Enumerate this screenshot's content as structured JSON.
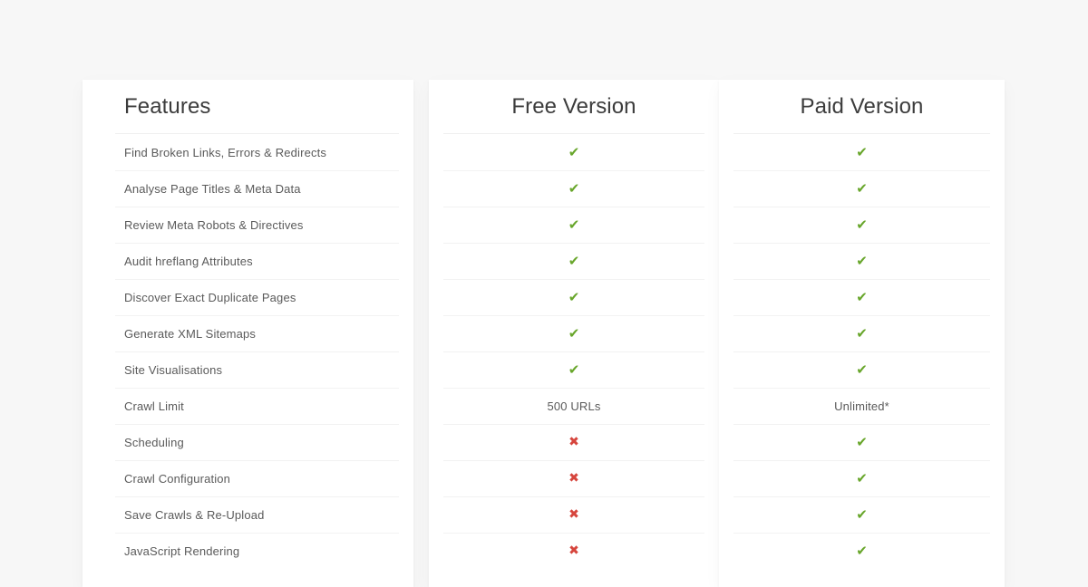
{
  "theme": {
    "page_background": "#f7f7f7",
    "card_background": "#ffffff",
    "divider": "#f2f2f2",
    "heading_color": "#3c3c3c",
    "text_color": "#5a5a5a",
    "yes_color": "#68a62b",
    "no_color": "#d6453d"
  },
  "table": {
    "columns": [
      {
        "key": "features",
        "label": "Features"
      },
      {
        "key": "free",
        "label": "Free Version"
      },
      {
        "key": "paid",
        "label": "Paid Version"
      }
    ],
    "icons": {
      "yes": "✔",
      "no": "✖",
      "yes_name": "check-icon",
      "no_name": "cross-icon"
    },
    "rows": [
      {
        "feature": "Find Broken Links, Errors & Redirects",
        "free": "✔",
        "paid": "✔",
        "free_type": "yes",
        "paid_type": "yes"
      },
      {
        "feature": "Analyse Page Titles & Meta Data",
        "free": "✔",
        "paid": "✔",
        "free_type": "yes",
        "paid_type": "yes"
      },
      {
        "feature": "Review Meta Robots & Directives",
        "free": "✔",
        "paid": "✔",
        "free_type": "yes",
        "paid_type": "yes"
      },
      {
        "feature": "Audit hreflang Attributes",
        "free": "✔",
        "paid": "✔",
        "free_type": "yes",
        "paid_type": "yes"
      },
      {
        "feature": "Discover Exact Duplicate Pages",
        "free": "✔",
        "paid": "✔",
        "free_type": "yes",
        "paid_type": "yes"
      },
      {
        "feature": "Generate XML Sitemaps",
        "free": "✔",
        "paid": "✔",
        "free_type": "yes",
        "paid_type": "yes"
      },
      {
        "feature": "Site Visualisations",
        "free": "✔",
        "paid": "✔",
        "free_type": "yes",
        "paid_type": "yes"
      },
      {
        "feature": "Crawl Limit",
        "free": "500 URLs",
        "paid": "Unlimited*",
        "free_type": "text",
        "paid_type": "text"
      },
      {
        "feature": "Scheduling",
        "free": "✖",
        "paid": "✔",
        "free_type": "no",
        "paid_type": "yes"
      },
      {
        "feature": "Crawl Configuration",
        "free": "✖",
        "paid": "✔",
        "free_type": "no",
        "paid_type": "yes"
      },
      {
        "feature": "Save Crawls & Re-Upload",
        "free": "✖",
        "paid": "✔",
        "free_type": "no",
        "paid_type": "yes"
      },
      {
        "feature": "JavaScript Rendering",
        "free": "✖",
        "paid": "✔",
        "free_type": "no",
        "paid_type": "yes"
      }
    ]
  }
}
